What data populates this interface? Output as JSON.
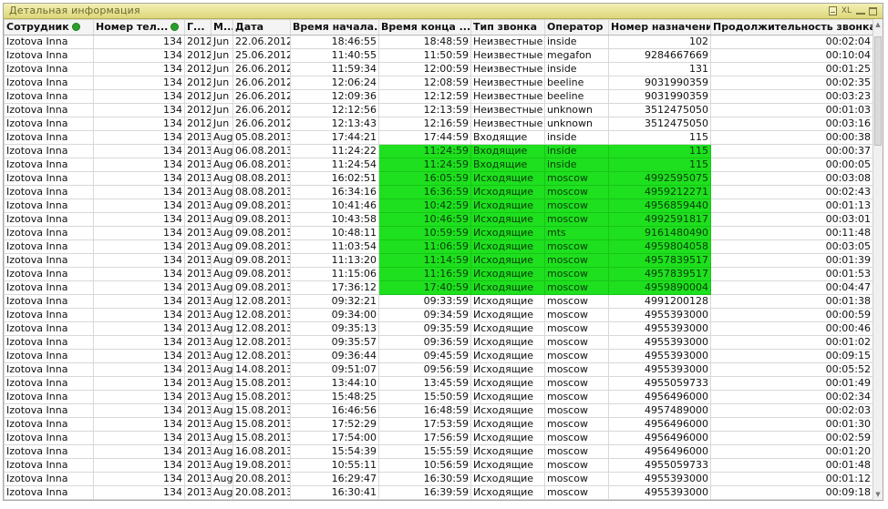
{
  "window": {
    "title": "Детальная информация",
    "caption_buttons": {
      "export": "XL"
    }
  },
  "colors": {
    "highlight": "#1ee01e",
    "caption": "#dcd77a"
  },
  "columns": [
    "Сотрудник",
    "Номер тел...",
    "Г...",
    "М...",
    "Дата",
    "Время начала...",
    "Время конца ...",
    "Тип звонка",
    "Оператор",
    "Номер назначения",
    "Продолжительность звонка"
  ],
  "rows": [
    [
      "Izotova Inna",
      "134",
      "2012",
      "Jun",
      "22.06.2012",
      "18:46:55",
      "18:48:59",
      "Неизвестные",
      "inside",
      "102",
      "00:02:04"
    ],
    [
      "Izotova Inna",
      "134",
      "2012",
      "Jun",
      "25.06.2012",
      "11:40:55",
      "11:50:59",
      "Неизвестные",
      "megafon",
      "9284667669",
      "00:10:04"
    ],
    [
      "Izotova Inna",
      "134",
      "2012",
      "Jun",
      "26.06.2012",
      "11:59:34",
      "12:00:59",
      "Неизвестные",
      "inside",
      "131",
      "00:01:25"
    ],
    [
      "Izotova Inna",
      "134",
      "2012",
      "Jun",
      "26.06.2012",
      "12:06:24",
      "12:08:59",
      "Неизвестные",
      "beeline",
      "9031990359",
      "00:02:35"
    ],
    [
      "Izotova Inna",
      "134",
      "2012",
      "Jun",
      "26.06.2012",
      "12:09:36",
      "12:12:59",
      "Неизвестные",
      "beeline",
      "9031990359",
      "00:03:23"
    ],
    [
      "Izotova Inna",
      "134",
      "2012",
      "Jun",
      "26.06.2012",
      "12:12:56",
      "12:13:59",
      "Неизвестные",
      "unknown",
      "3512475050",
      "00:01:03"
    ],
    [
      "Izotova Inna",
      "134",
      "2012",
      "Jun",
      "26.06.2012",
      "12:13:43",
      "12:16:59",
      "Неизвестные",
      "unknown",
      "3512475050",
      "00:03:16"
    ],
    [
      "Izotova Inna",
      "134",
      "2013",
      "Aug",
      "05.08.2013",
      "17:44:21",
      "17:44:59",
      "Входящие",
      "inside",
      "115",
      "00:00:38"
    ],
    [
      "Izotova Inna",
      "134",
      "2013",
      "Aug",
      "06.08.2013",
      "11:24:22",
      "11:24:59",
      "Входящие",
      "inside",
      "115",
      "00:00:37"
    ],
    [
      "Izotova Inna",
      "134",
      "2013",
      "Aug",
      "06.08.2013",
      "11:24:54",
      "11:24:59",
      "Входящие",
      "inside",
      "115",
      "00:00:05"
    ],
    [
      "Izotova Inna",
      "134",
      "2013",
      "Aug",
      "08.08.2013",
      "16:02:51",
      "16:05:59",
      "Исходящие",
      "moscow",
      "4992595075",
      "00:03:08"
    ],
    [
      "Izotova Inna",
      "134",
      "2013",
      "Aug",
      "08.08.2013",
      "16:34:16",
      "16:36:59",
      "Исходящие",
      "moscow",
      "4959212271",
      "00:02:43"
    ],
    [
      "Izotova Inna",
      "134",
      "2013",
      "Aug",
      "09.08.2013",
      "10:41:46",
      "10:42:59",
      "Исходящие",
      "moscow",
      "4956859440",
      "00:01:13"
    ],
    [
      "Izotova Inna",
      "134",
      "2013",
      "Aug",
      "09.08.2013",
      "10:43:58",
      "10:46:59",
      "Исходящие",
      "moscow",
      "4992591817",
      "00:03:01"
    ],
    [
      "Izotova Inna",
      "134",
      "2013",
      "Aug",
      "09.08.2013",
      "10:48:11",
      "10:59:59",
      "Исходящие",
      "mts",
      "9161480490",
      "00:11:48"
    ],
    [
      "Izotova Inna",
      "134",
      "2013",
      "Aug",
      "09.08.2013",
      "11:03:54",
      "11:06:59",
      "Исходящие",
      "moscow",
      "4959804058",
      "00:03:05"
    ],
    [
      "Izotova Inna",
      "134",
      "2013",
      "Aug",
      "09.08.2013",
      "11:13:20",
      "11:14:59",
      "Исходящие",
      "moscow",
      "4957839517",
      "00:01:39"
    ],
    [
      "Izotova Inna",
      "134",
      "2013",
      "Aug",
      "09.08.2013",
      "11:15:06",
      "11:16:59",
      "Исходящие",
      "moscow",
      "4957839517",
      "00:01:53"
    ],
    [
      "Izotova Inna",
      "134",
      "2013",
      "Aug",
      "09.08.2013",
      "17:36:12",
      "17:40:59",
      "Исходящие",
      "moscow",
      "4959890004",
      "00:04:47"
    ],
    [
      "Izotova Inna",
      "134",
      "2013",
      "Aug",
      "12.08.2013",
      "09:32:21",
      "09:33:59",
      "Исходящие",
      "moscow",
      "4991200128",
      "00:01:38"
    ],
    [
      "Izotova Inna",
      "134",
      "2013",
      "Aug",
      "12.08.2013",
      "09:34:00",
      "09:34:59",
      "Исходящие",
      "moscow",
      "4955393000",
      "00:00:59"
    ],
    [
      "Izotova Inna",
      "134",
      "2013",
      "Aug",
      "12.08.2013",
      "09:35:13",
      "09:35:59",
      "Исходящие",
      "moscow",
      "4955393000",
      "00:00:46"
    ],
    [
      "Izotova Inna",
      "134",
      "2013",
      "Aug",
      "12.08.2013",
      "09:35:57",
      "09:36:59",
      "Исходящие",
      "moscow",
      "4955393000",
      "00:01:02"
    ],
    [
      "Izotova Inna",
      "134",
      "2013",
      "Aug",
      "12.08.2013",
      "09:36:44",
      "09:45:59",
      "Исходящие",
      "moscow",
      "4955393000",
      "00:09:15"
    ],
    [
      "Izotova Inna",
      "134",
      "2013",
      "Aug",
      "14.08.2013",
      "09:51:07",
      "09:56:59",
      "Исходящие",
      "moscow",
      "4955393000",
      "00:05:52"
    ],
    [
      "Izotova Inna",
      "134",
      "2013",
      "Aug",
      "15.08.2013",
      "13:44:10",
      "13:45:59",
      "Исходящие",
      "moscow",
      "4955059733",
      "00:01:49"
    ],
    [
      "Izotova Inna",
      "134",
      "2013",
      "Aug",
      "15.08.2013",
      "15:48:25",
      "15:50:59",
      "Исходящие",
      "moscow",
      "4956496000",
      "00:02:34"
    ],
    [
      "Izotova Inna",
      "134",
      "2013",
      "Aug",
      "15.08.2013",
      "16:46:56",
      "16:48:59",
      "Исходящие",
      "moscow",
      "4957489000",
      "00:02:03"
    ],
    [
      "Izotova Inna",
      "134",
      "2013",
      "Aug",
      "15.08.2013",
      "17:52:29",
      "17:53:59",
      "Исходящие",
      "moscow",
      "4956496000",
      "00:01:30"
    ],
    [
      "Izotova Inna",
      "134",
      "2013",
      "Aug",
      "15.08.2013",
      "17:54:00",
      "17:56:59",
      "Исходящие",
      "moscow",
      "4956496000",
      "00:02:59"
    ],
    [
      "Izotova Inna",
      "134",
      "2013",
      "Aug",
      "16.08.2013",
      "15:54:39",
      "15:55:59",
      "Исходящие",
      "moscow",
      "4956496000",
      "00:01:20"
    ],
    [
      "Izotova Inna",
      "134",
      "2013",
      "Aug",
      "19.08.2013",
      "10:55:11",
      "10:56:59",
      "Исходящие",
      "moscow",
      "4955059733",
      "00:01:48"
    ],
    [
      "Izotova Inna",
      "134",
      "2013",
      "Aug",
      "20.08.2013",
      "16:29:47",
      "16:30:59",
      "Исходящие",
      "moscow",
      "4955393000",
      "00:01:12"
    ],
    [
      "Izotova Inna",
      "134",
      "2013",
      "Aug",
      "20.08.2013",
      "16:30:41",
      "16:39:59",
      "Исходящие",
      "moscow",
      "4955393000",
      "00:09:18"
    ]
  ],
  "highlighted_rows": [
    8,
    9,
    10,
    11,
    12,
    13,
    14,
    15,
    16,
    17,
    18
  ],
  "highlighted_columns": [
    6,
    7,
    8,
    9
  ]
}
